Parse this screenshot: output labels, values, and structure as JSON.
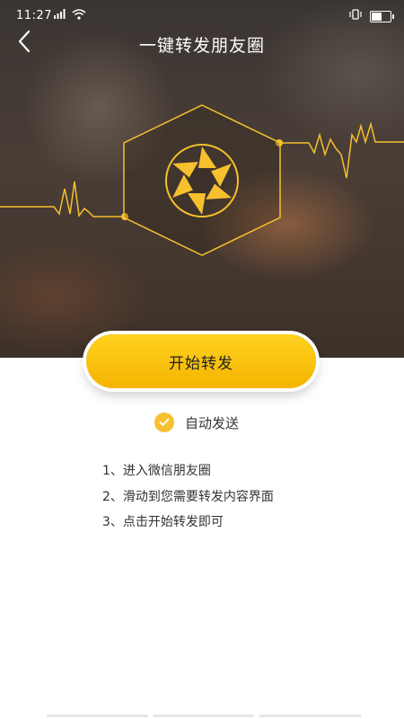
{
  "status_bar": {
    "time": "11:27",
    "icons": [
      "signal-icon",
      "wifi-icon",
      "vibrate-icon",
      "battery-icon"
    ],
    "battery_level": 0.6
  },
  "nav": {
    "back_icon": "chevron-left-icon",
    "title": "一键转发朋友圈"
  },
  "hero": {
    "center_icon": "aperture-icon",
    "accent_color": "#f6c02e"
  },
  "actions": {
    "start_button_label": "开始转发",
    "auto_send_label": "自动发送",
    "auto_send_checked": true
  },
  "steps": [
    "1、进入微信朋友圈",
    "2、滑动到您需要转发内容界面",
    "3、点击开始转发即可"
  ],
  "colors": {
    "primary": "#f6c02e",
    "button_gradient_top": "#ffd21f",
    "button_gradient_bottom": "#f4b400",
    "text": "#333333"
  }
}
